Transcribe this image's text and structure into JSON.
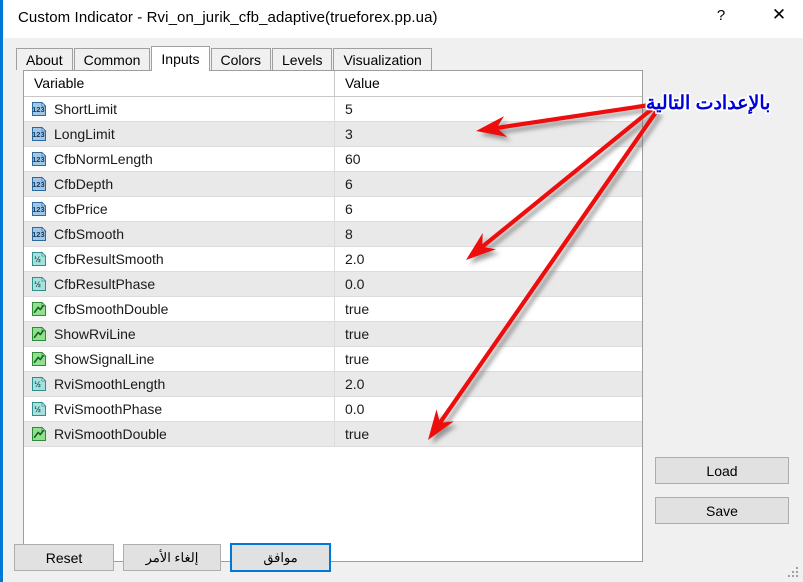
{
  "window": {
    "title": "Custom Indicator - Rvi_on_jurik_cfb_adaptive(trueforex.pp.ua)",
    "help_label": "?",
    "close_label": "✕",
    "border_color": "#0078d7"
  },
  "tabs": [
    {
      "label": "About",
      "active": false
    },
    {
      "label": "Common",
      "active": false
    },
    {
      "label": "Inputs",
      "active": true
    },
    {
      "label": "Colors",
      "active": false
    },
    {
      "label": "Levels",
      "active": false
    },
    {
      "label": "Visualization",
      "active": false
    }
  ],
  "table": {
    "columns": [
      "Variable",
      "Value"
    ],
    "rows": [
      {
        "icon": "integer-icon",
        "variable": "ShortLimit",
        "value": "5"
      },
      {
        "icon": "integer-icon",
        "variable": "LongLimit",
        "value": "3"
      },
      {
        "icon": "integer-icon",
        "variable": "CfbNormLength",
        "value": "60"
      },
      {
        "icon": "integer-icon",
        "variable": "CfbDepth",
        "value": "6"
      },
      {
        "icon": "integer-icon",
        "variable": "CfbPrice",
        "value": "6"
      },
      {
        "icon": "integer-icon",
        "variable": "CfbSmooth",
        "value": "8"
      },
      {
        "icon": "double-icon",
        "variable": "CfbResultSmooth",
        "value": "2.0"
      },
      {
        "icon": "double-icon",
        "variable": "CfbResultPhase",
        "value": "0.0"
      },
      {
        "icon": "boolean-icon",
        "variable": "CfbSmoothDouble",
        "value": "true"
      },
      {
        "icon": "boolean-icon",
        "variable": "ShowRviLine",
        "value": "true"
      },
      {
        "icon": "boolean-icon",
        "variable": "ShowSignalLine",
        "value": "true"
      },
      {
        "icon": "double-icon",
        "variable": "RviSmoothLength",
        "value": "2.0"
      },
      {
        "icon": "double-icon",
        "variable": "RviSmoothPhase",
        "value": "0.0"
      },
      {
        "icon": "boolean-icon",
        "variable": "RviSmoothDouble",
        "value": "true"
      }
    ]
  },
  "side_buttons": {
    "load_label": "Load",
    "save_label": "Save"
  },
  "footer": {
    "reset_label": "Reset",
    "cancel_label": "إلغاء الأمر",
    "ok_label": "موافق"
  },
  "annotation": {
    "text": "بالإعدادت التالية",
    "text_color": "#0000dd",
    "arrow_color": "#ee1111",
    "arrow_targets": [
      "LongLimit",
      "CfbResultSmooth",
      "RviSmoothDouble"
    ]
  }
}
